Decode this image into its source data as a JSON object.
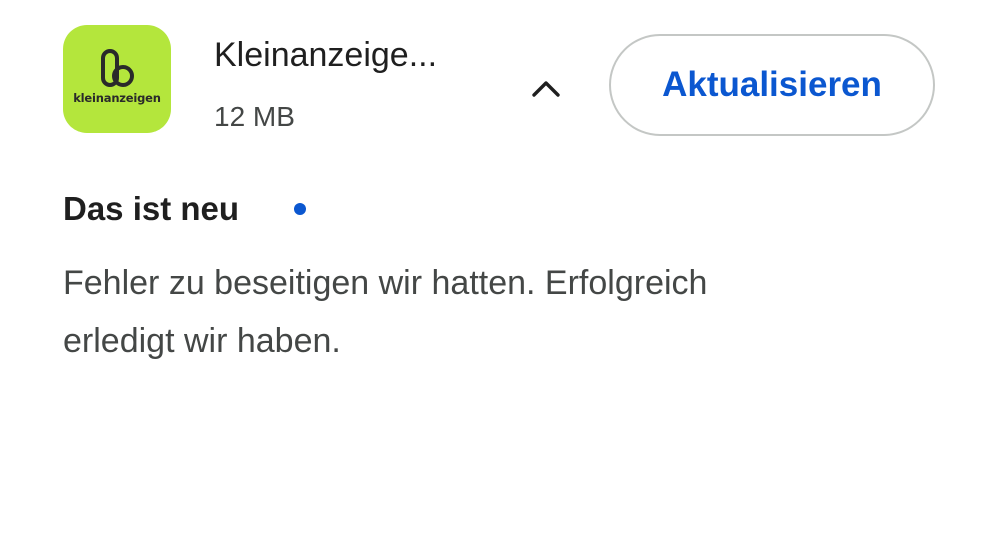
{
  "app": {
    "name": "Kleinanzeige...",
    "size": "12 MB",
    "icon": {
      "name": "kleinanzeigen-logo-icon",
      "wordmark": "kleinanzeigen",
      "background_color": "#b4e63c"
    }
  },
  "controls": {
    "collapse_icon": "chevron-up-icon",
    "update_label": "Aktualisieren",
    "accent_color": "#0b57d0"
  },
  "whats_new": {
    "heading": "Das ist neu",
    "indicator_color": "#0b57d0",
    "notes": [
      "Fehler zu beseitigen wir hatten. Erfolgreich",
      "erledigt wir haben."
    ]
  }
}
